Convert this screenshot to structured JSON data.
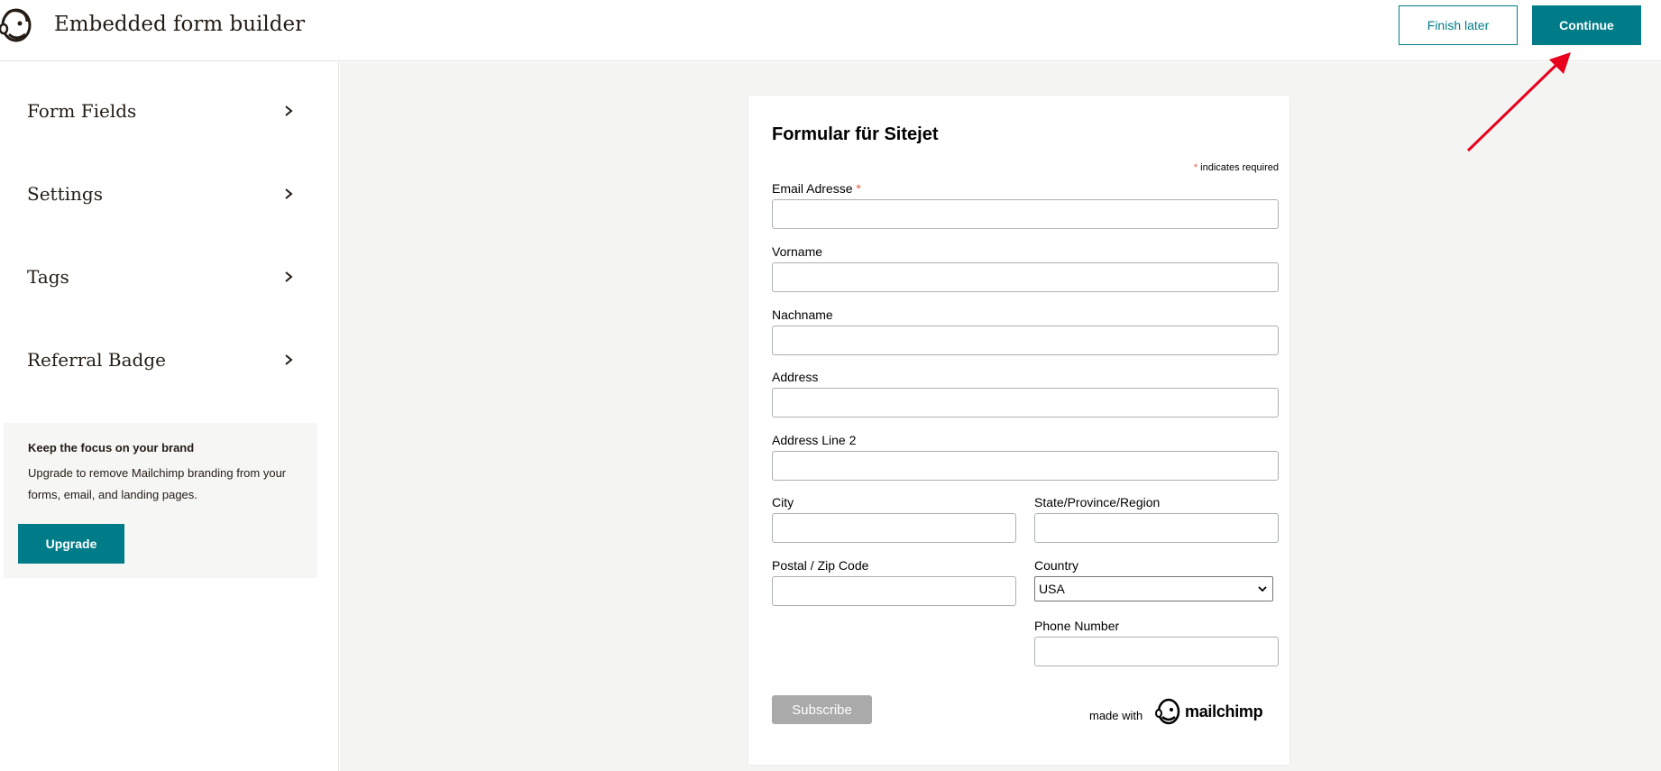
{
  "header": {
    "logo_icon": "mailchimp-freddie-icon",
    "title": "Embedded form builder",
    "finish_later": "Finish later",
    "continue": "Continue"
  },
  "sidebar": {
    "items": [
      {
        "label": "Form Fields"
      },
      {
        "label": "Settings"
      },
      {
        "label": "Tags"
      },
      {
        "label": "Referral Badge"
      }
    ],
    "promo": {
      "title": "Keep the focus on your brand",
      "text": "Upgrade to remove Mailchimp branding from your forms, email, and landing pages.",
      "button": "Upgrade"
    }
  },
  "form": {
    "title": "Formular für Sitejet",
    "required_star": "*",
    "required_note": "indicates required",
    "fields": {
      "email": "Email Adresse",
      "vorname": "Vorname",
      "nachname": "Nachname",
      "address": "Address",
      "address2": "Address Line 2",
      "city": "City",
      "state": "State/Province/Region",
      "zip": "Postal / Zip Code",
      "country": "Country",
      "country_value": "USA",
      "phone": "Phone Number"
    },
    "subscribe": "Subscribe",
    "made_with": "made with",
    "brand": "mailchimp"
  },
  "annotation": {
    "arrow_color": "#e8001c"
  },
  "colors": {
    "accent": "#007c89",
    "canvas_bg": "#f4f4f2",
    "required": "#e85c41"
  }
}
